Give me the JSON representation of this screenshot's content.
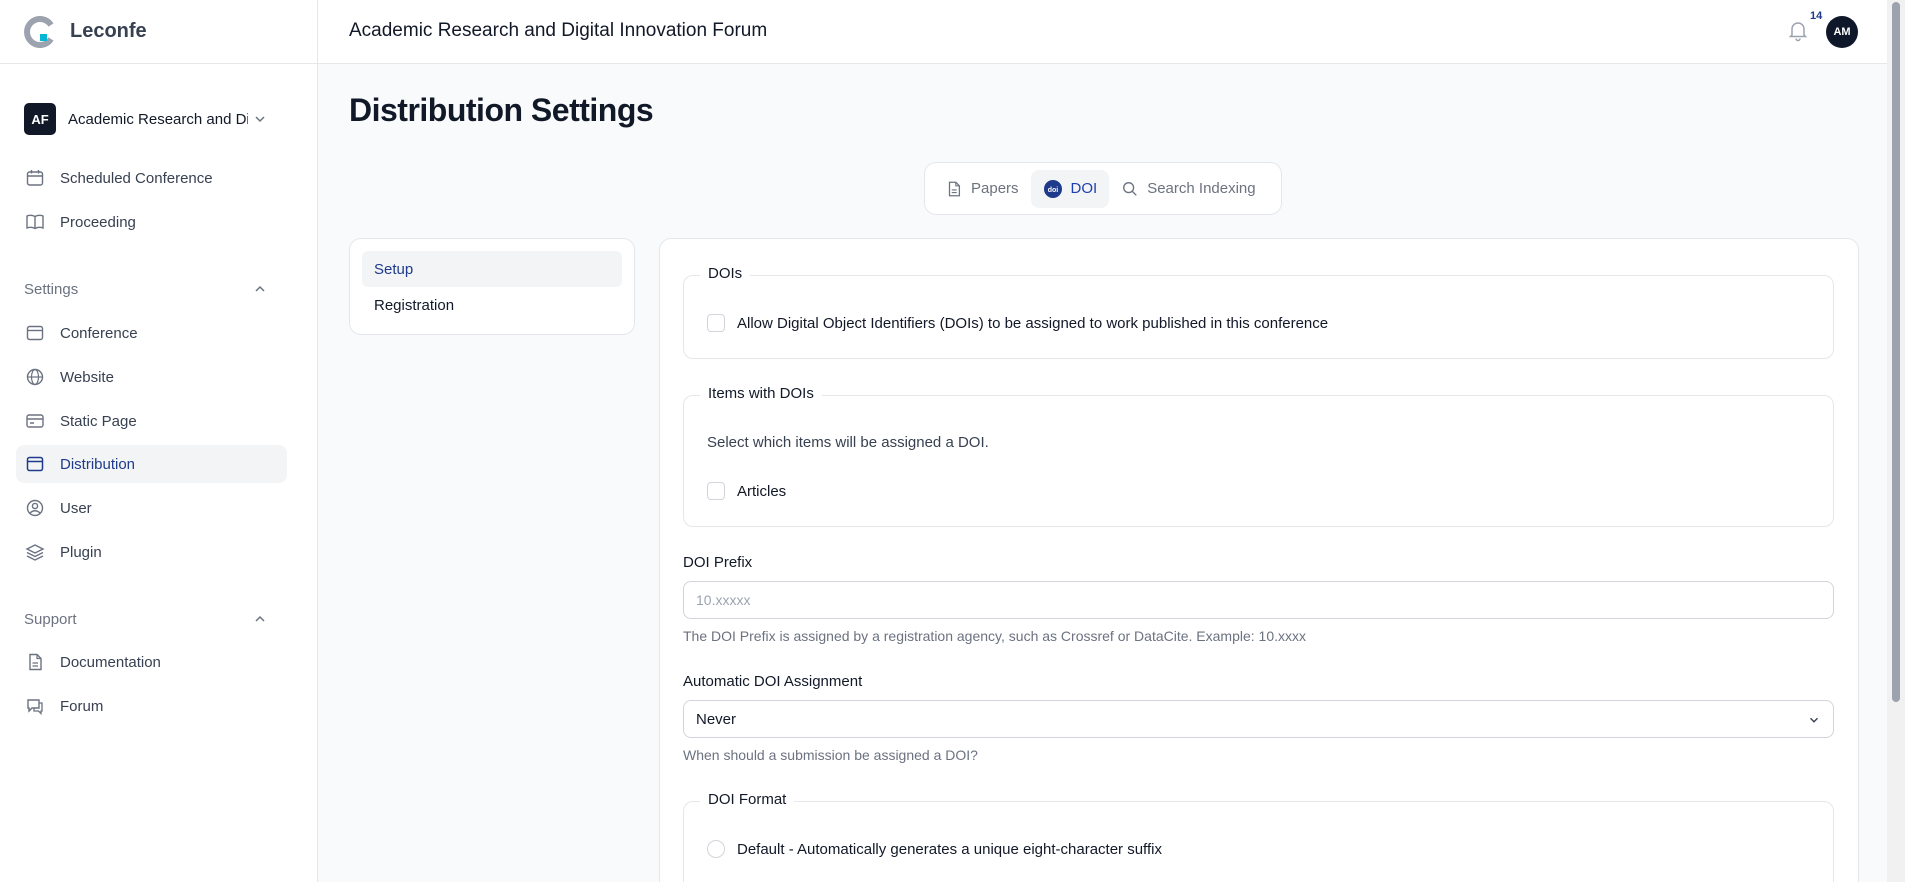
{
  "brand": {
    "name": "Leconfe"
  },
  "header": {
    "title": "Academic Research and Digital Innovation Forum",
    "notifications": "14",
    "avatar_initials": "AM"
  },
  "conference_switcher": {
    "badge": "AF",
    "name": "Academic Research and Digital Innovation Forum"
  },
  "sidebar": {
    "top_items": [
      {
        "label": "Scheduled Conference",
        "icon": "calendar-icon"
      },
      {
        "label": "Proceeding",
        "icon": "book-icon"
      }
    ],
    "settings_group": "Settings",
    "settings_items": [
      {
        "label": "Conference",
        "icon": "window-icon"
      },
      {
        "label": "Website",
        "icon": "globe-icon"
      },
      {
        "label": "Static Page",
        "icon": "card-icon"
      },
      {
        "label": "Distribution",
        "icon": "window-icon",
        "active": true
      },
      {
        "label": "User",
        "icon": "user-circle-icon"
      },
      {
        "label": "Plugin",
        "icon": "layers-icon"
      }
    ],
    "support_group": "Support",
    "support_items": [
      {
        "label": "Documentation",
        "icon": "document-icon"
      },
      {
        "label": "Forum",
        "icon": "chat-icon"
      }
    ]
  },
  "page": {
    "title": "Distribution Settings"
  },
  "tabs": [
    {
      "label": "Papers",
      "icon": "document-icon"
    },
    {
      "label": "DOI",
      "icon": "doi-icon",
      "active": true
    },
    {
      "label": "Search Indexing",
      "icon": "search-icon"
    }
  ],
  "subnav": [
    {
      "label": "Setup",
      "active": true
    },
    {
      "label": "Registration"
    }
  ],
  "form": {
    "dois_legend": "DOIs",
    "dois_checkbox": "Allow Digital Object Identifiers (DOIs) to be assigned to work published in this conference",
    "items_legend": "Items with DOIs",
    "items_help": "Select which items will be assigned a DOI.",
    "items_checkbox": "Articles",
    "prefix_label": "DOI Prefix",
    "prefix_placeholder": "10.xxxxx",
    "prefix_help": "The DOI Prefix is assigned by a registration agency, such as Crossref or DataCite. Example: 10.xxxx",
    "assignment_label": "Automatic DOI Assignment",
    "assignment_value": "Never",
    "assignment_help": "When should a submission be assigned a DOI?",
    "format_legend": "DOI Format",
    "format_default": "Default - Automatically generates a unique eight-character suffix"
  },
  "colors": {
    "accent": "#1e3a8a",
    "brand_dot": "#06b6d4"
  }
}
